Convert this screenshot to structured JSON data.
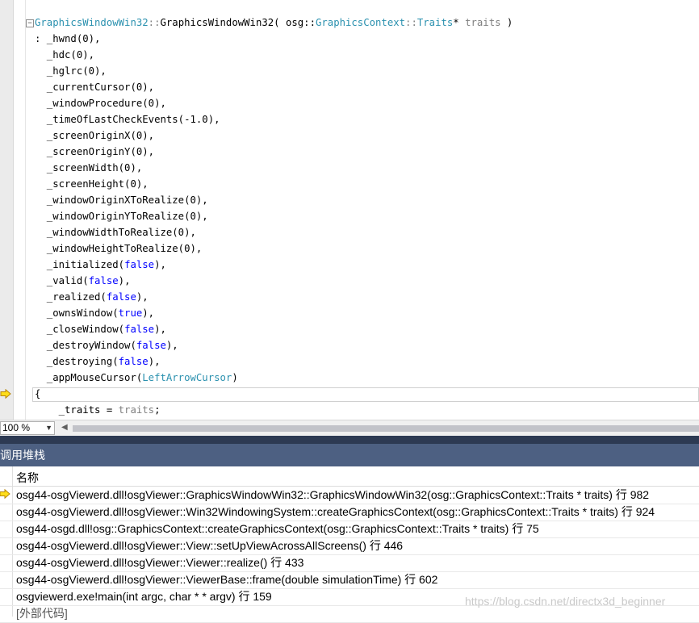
{
  "editor": {
    "lines": [
      {
        "parts": [
          {
            "s": "t",
            "v": "GraphicsWindowWin32"
          },
          {
            "s": "p",
            "v": "::"
          },
          {
            "s": "",
            "v": "GraphicsWindowWin32( osg::"
          },
          {
            "s": "t",
            "v": "GraphicsContext"
          },
          {
            "s": "p",
            "v": "::"
          },
          {
            "s": "t",
            "v": "Traits"
          },
          {
            "s": "",
            "v": "* "
          },
          {
            "s": "p",
            "v": "traits"
          },
          {
            "s": "",
            "v": " )"
          }
        ]
      },
      {
        "parts": [
          {
            "s": "",
            "v": ": _hwnd(0),"
          }
        ]
      },
      {
        "parts": [
          {
            "s": "",
            "v": "  _hdc(0),"
          }
        ]
      },
      {
        "parts": [
          {
            "s": "",
            "v": "  _hglrc(0),"
          }
        ]
      },
      {
        "parts": [
          {
            "s": "",
            "v": "  _currentCursor(0),"
          }
        ]
      },
      {
        "parts": [
          {
            "s": "",
            "v": "  _windowProcedure(0),"
          }
        ]
      },
      {
        "parts": [
          {
            "s": "",
            "v": "  _timeOfLastCheckEvents(-1.0),"
          }
        ]
      },
      {
        "parts": [
          {
            "s": "",
            "v": "  _screenOriginX(0),"
          }
        ]
      },
      {
        "parts": [
          {
            "s": "",
            "v": "  _screenOriginY(0),"
          }
        ]
      },
      {
        "parts": [
          {
            "s": "",
            "v": "  _screenWidth(0),"
          }
        ]
      },
      {
        "parts": [
          {
            "s": "",
            "v": "  _screenHeight(0),"
          }
        ]
      },
      {
        "parts": [
          {
            "s": "",
            "v": "  _windowOriginXToRealize(0),"
          }
        ]
      },
      {
        "parts": [
          {
            "s": "",
            "v": "  _windowOriginYToRealize(0),"
          }
        ]
      },
      {
        "parts": [
          {
            "s": "",
            "v": "  _windowWidthToRealize(0),"
          }
        ]
      },
      {
        "parts": [
          {
            "s": "",
            "v": "  _windowHeightToRealize(0),"
          }
        ]
      },
      {
        "parts": [
          {
            "s": "",
            "v": "  _initialized("
          },
          {
            "s": "k",
            "v": "false"
          },
          {
            "s": "",
            "v": "),"
          }
        ]
      },
      {
        "parts": [
          {
            "s": "",
            "v": "  _valid("
          },
          {
            "s": "k",
            "v": "false"
          },
          {
            "s": "",
            "v": "),"
          }
        ]
      },
      {
        "parts": [
          {
            "s": "",
            "v": "  _realized("
          },
          {
            "s": "k",
            "v": "false"
          },
          {
            "s": "",
            "v": "),"
          }
        ]
      },
      {
        "parts": [
          {
            "s": "",
            "v": "  _ownsWindow("
          },
          {
            "s": "k",
            "v": "true"
          },
          {
            "s": "",
            "v": "),"
          }
        ]
      },
      {
        "parts": [
          {
            "s": "",
            "v": "  _closeWindow("
          },
          {
            "s": "k",
            "v": "false"
          },
          {
            "s": "",
            "v": "),"
          }
        ]
      },
      {
        "parts": [
          {
            "s": "",
            "v": "  _destroyWindow("
          },
          {
            "s": "k",
            "v": "false"
          },
          {
            "s": "",
            "v": "),"
          }
        ]
      },
      {
        "parts": [
          {
            "s": "",
            "v": "  _destroying("
          },
          {
            "s": "k",
            "v": "false"
          },
          {
            "s": "",
            "v": "),"
          }
        ]
      },
      {
        "parts": [
          {
            "s": "",
            "v": "  _appMouseCursor("
          },
          {
            "s": "t",
            "v": "LeftArrowCursor"
          },
          {
            "s": "",
            "v": ")"
          }
        ]
      },
      {
        "parts": [
          {
            "s": "",
            "v": "{"
          }
        ]
      },
      {
        "parts": [
          {
            "s": "",
            "v": "    _traits = "
          },
          {
            "s": "p",
            "v": "traits"
          },
          {
            "s": "",
            "v": ";"
          }
        ]
      }
    ],
    "collapse_glyph": "−",
    "zoom_value": "100 %",
    "zoom_dropdown_glyph": "▼",
    "scroll_left_glyph": "◀"
  },
  "call_stack": {
    "title": "调用堆栈",
    "column_name": "名称",
    "current_frame_index": 0,
    "frames": [
      "osg44-osgViewerd.dll!osgViewer::GraphicsWindowWin32::GraphicsWindowWin32(osg::GraphicsContext::Traits * traits) 行 982",
      "osg44-osgViewerd.dll!osgViewer::Win32WindowingSystem::createGraphicsContext(osg::GraphicsContext::Traits * traits) 行 924",
      "osg44-osgd.dll!osg::GraphicsContext::createGraphicsContext(osg::GraphicsContext::Traits * traits) 行 75",
      "osg44-osgViewerd.dll!osgViewer::View::setUpViewAcrossAllScreens() 行 446",
      "osg44-osgViewerd.dll!osgViewer::Viewer::realize() 行 433",
      "osg44-osgViewerd.dll!osgViewer::ViewerBase::frame(double simulationTime) 行 602",
      "osgviewerd.exe!main(int argc, char * * argv) 行 159",
      "[外部代码]"
    ]
  },
  "watermark": "https://blog.csdn.net/directx3d_beginner",
  "colors": {
    "keyword": "#0000ff",
    "type": "#2b91af",
    "parameter": "#808080",
    "panel_header": "#4d6082",
    "arrow_fill": "#ffde1a",
    "arrow_stroke": "#b8860b"
  }
}
